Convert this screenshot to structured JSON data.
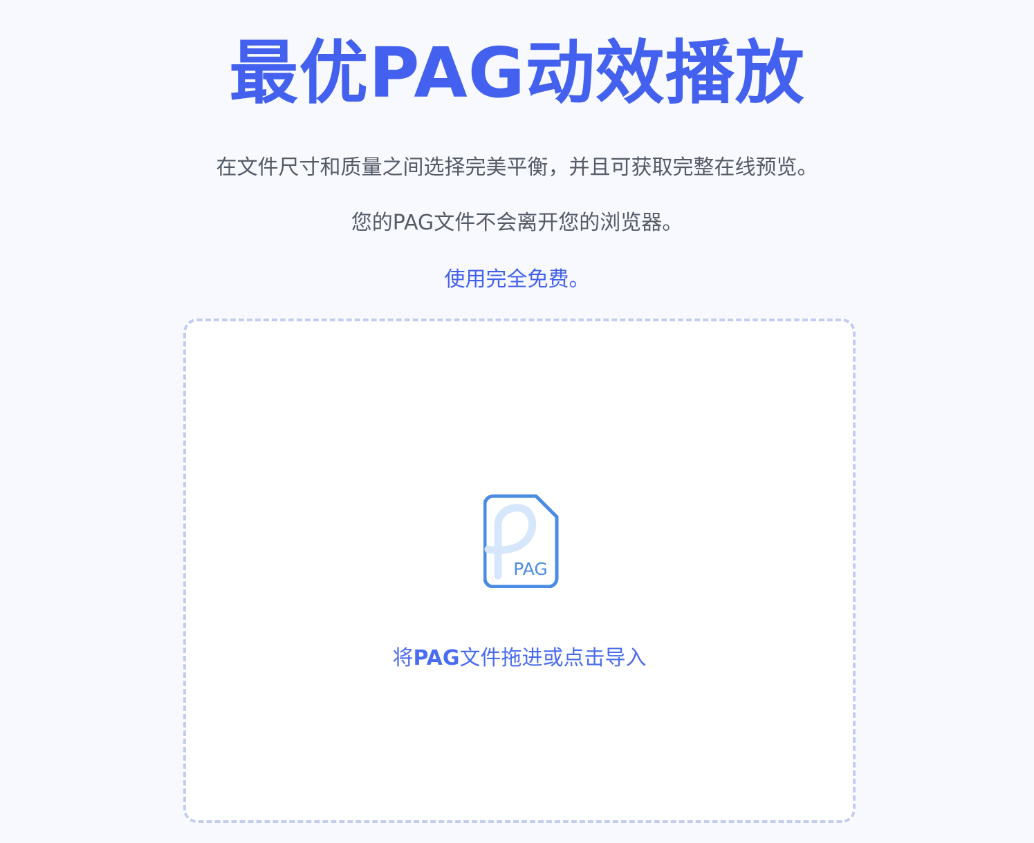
{
  "hero": {
    "title": "最优PAG动效播放",
    "line_1": "在文件尺寸和质量之间选择完美平衡，并且可获取完整在线预览。",
    "line_2": "您的PAG文件不会离开您的浏览器。",
    "line_3": "使用完全免费。"
  },
  "upload": {
    "icon": "pag-file-icon",
    "icon_label": "PAG",
    "prompt_prefix": "将",
    "prompt_format": "PAG",
    "prompt_suffix": "文件拖进或点击导入"
  },
  "colors": {
    "accent": "#4361ee",
    "icon_blue": "#4a8be3",
    "icon_light": "#d6e6fb",
    "border_dash": "#c3cdf4",
    "background": "#f8f9fe"
  }
}
